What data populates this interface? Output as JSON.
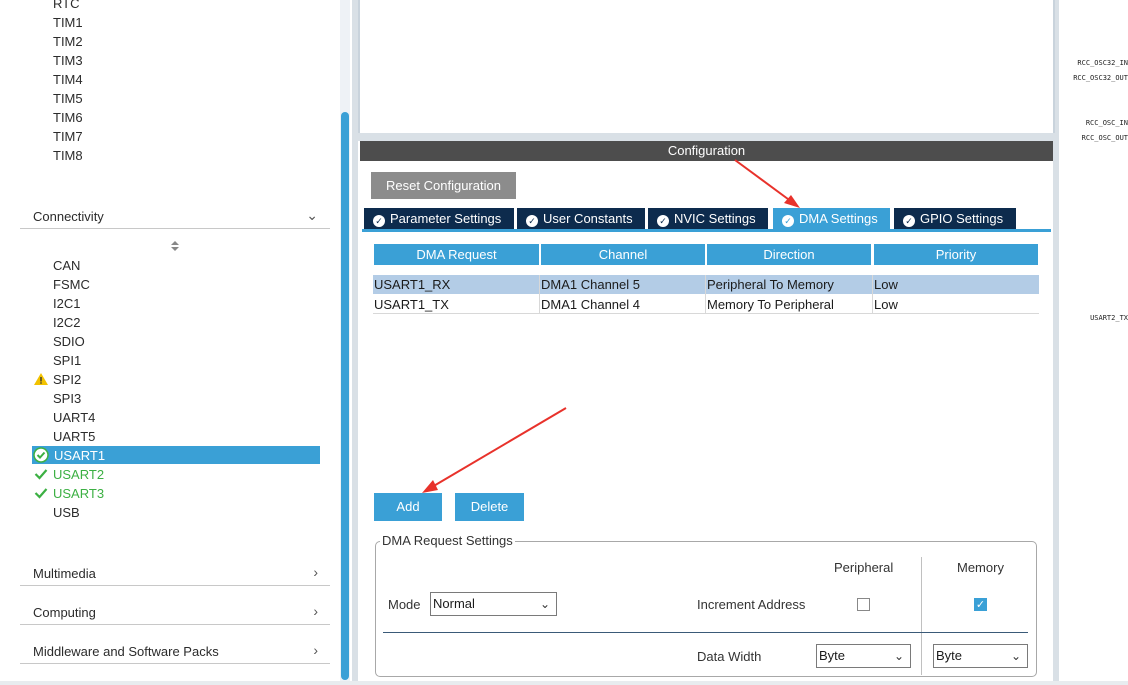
{
  "left_panel": {
    "timers": [
      "RTC",
      "TIM1",
      "TIM2",
      "TIM3",
      "TIM4",
      "TIM5",
      "TIM6",
      "TIM7",
      "TIM8"
    ],
    "connectivity_label": "Connectivity",
    "sort_icon": "sort-updown-icon",
    "connectivity_items": [
      {
        "label": "CAN",
        "status": "none"
      },
      {
        "label": "FSMC",
        "status": "none"
      },
      {
        "label": "I2C1",
        "status": "none"
      },
      {
        "label": "I2C2",
        "status": "none"
      },
      {
        "label": "SDIO",
        "status": "none"
      },
      {
        "label": "SPI1",
        "status": "none"
      },
      {
        "label": "SPI2",
        "status": "warning"
      },
      {
        "label": "SPI3",
        "status": "none"
      },
      {
        "label": "UART4",
        "status": "none"
      },
      {
        "label": "UART5",
        "status": "none"
      },
      {
        "label": "USART1",
        "status": "selected"
      },
      {
        "label": "USART2",
        "status": "configured"
      },
      {
        "label": "USART3",
        "status": "configured"
      },
      {
        "label": "USB",
        "status": "none"
      }
    ],
    "categories": [
      "Multimedia",
      "Computing",
      "Middleware and Software Packs"
    ]
  },
  "config": {
    "title": "Configuration",
    "reset_label": "Reset Configuration",
    "tabs": [
      {
        "label": "Parameter Settings",
        "active": false
      },
      {
        "label": "User Constants",
        "active": false
      },
      {
        "label": "NVIC Settings",
        "active": false
      },
      {
        "label": "DMA Settings",
        "active": true
      },
      {
        "label": "GPIO Settings",
        "active": false
      }
    ],
    "table": {
      "headers": [
        "DMA Request",
        "Channel",
        "Direction",
        "Priority"
      ],
      "rows": [
        [
          "USART1_RX",
          "DMA1 Channel 5",
          "Peripheral To Memory",
          "Low"
        ],
        [
          "USART1_TX",
          "DMA1 Channel 4",
          "Memory To Peripheral",
          "Low"
        ]
      ]
    },
    "add_label": "Add",
    "delete_label": "Delete",
    "request_settings": {
      "legend": "DMA Request Settings",
      "peripheral_label": "Peripheral",
      "memory_label": "Memory",
      "mode_label": "Mode",
      "mode_value": "Normal",
      "increment_label": "Increment Address",
      "peripheral_increment": false,
      "memory_increment": true,
      "data_width_label": "Data Width",
      "peripheral_width": "Byte",
      "memory_width": "Byte"
    }
  },
  "pinout": [
    "RCC_OSC32_IN",
    "RCC_OSC32_OUT",
    "RCC_OSC_IN",
    "RCC_OSC_OUT",
    "USART2_TX"
  ],
  "colors": {
    "accent": "#3aa0d6",
    "tab_dark": "#0d2b4d",
    "ok_green": "#3cb043",
    "warn_yellow": "#f2c200",
    "arrow_red": "#e8322b"
  }
}
